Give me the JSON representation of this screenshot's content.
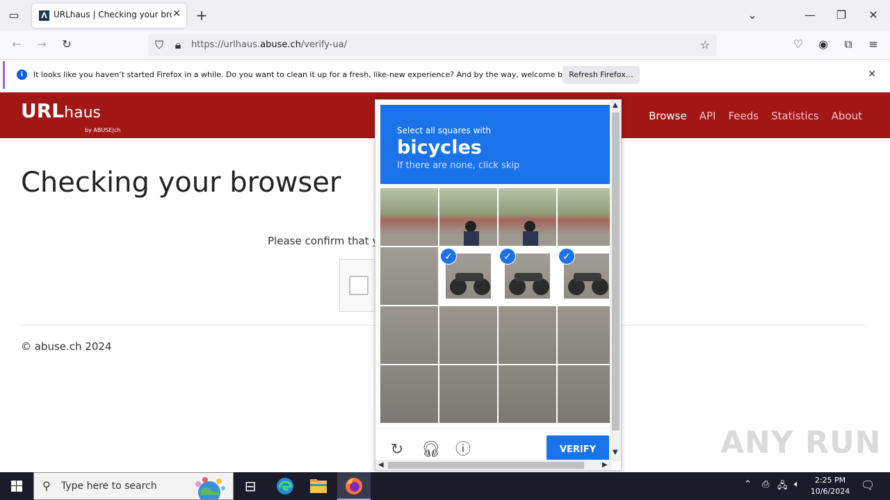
{
  "browser": {
    "tab_title": "URLhaus | Checking your browser",
    "url_prefix": "https://urlhaus.",
    "url_domain": "abuse.ch",
    "url_path": "/verify-ua/"
  },
  "notification": {
    "message": "It looks like you haven’t started Firefox in a while. Do you want to clean it up for a fresh, like-new experience? And by the way, welcome back!",
    "button": "Refresh Firefox…"
  },
  "site": {
    "logo_main": "URL",
    "logo_sub": "haus",
    "logo_by": "by ABUSE|ch",
    "nav": [
      "Browse",
      "API",
      "Feeds",
      "Statistics",
      "About"
    ],
    "heading": "Checking your browser",
    "confirm_text": "Please confirm that yo",
    "footer": "© abuse.ch 2024"
  },
  "captcha": {
    "instruction": "Select all squares with",
    "target": "bicycles",
    "hint": "If there are none, click skip",
    "verify_label": "VERIFY",
    "selected": [
      5,
      6,
      7
    ]
  },
  "watermark": "ANY RUN",
  "taskbar": {
    "search_placeholder": "Type here to search",
    "time": "2:25 PM",
    "date": "10/6/2024"
  },
  "colors": {
    "site_header": "#a21616",
    "captcha_blue": "#1a73e8",
    "taskbar": "#1b1b2a"
  }
}
